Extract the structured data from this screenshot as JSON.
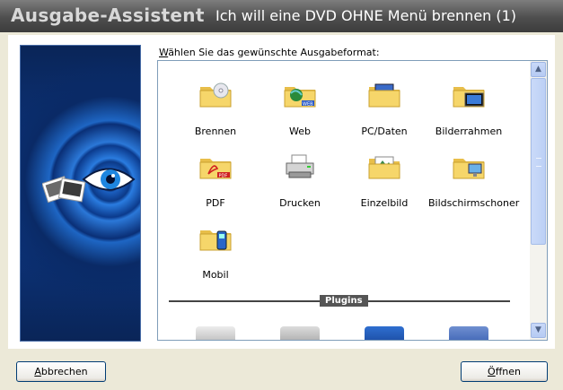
{
  "window": {
    "title_left": "Ausgabe-Assistent",
    "title_right": "Ich will eine DVD OHNE Menü brennen (1)"
  },
  "prompt": {
    "accelerator": "W",
    "rest": "ählen Sie das gewünschte Ausgabeformat:"
  },
  "formats": [
    {
      "label": "Brennen",
      "icon": "folder-disc-icon"
    },
    {
      "label": "Web",
      "icon": "folder-web-icon"
    },
    {
      "label": "PC/Daten",
      "icon": "folder-pc-icon"
    },
    {
      "label": "Bilderrahmen",
      "icon": "folder-photoframe-icon"
    },
    {
      "label": "PDF",
      "icon": "folder-pdf-icon"
    },
    {
      "label": "Drucken",
      "icon": "printer-icon"
    },
    {
      "label": "Einzelbild",
      "icon": "folder-picture-icon"
    },
    {
      "label": "Bildschirmschoner",
      "icon": "folder-monitor-icon"
    },
    {
      "label": "Mobil",
      "icon": "folder-phone-icon"
    }
  ],
  "section": {
    "plugins_label": "Plugins"
  },
  "buttons": {
    "cancel_accel": "A",
    "cancel_rest": "bbrechen",
    "open_accel": "Ö",
    "open_rest": "ffnen"
  },
  "colors": {
    "titlebar": "#4e4e4e",
    "banner": "#0d3a8a",
    "folder": "#f6d66a",
    "scrollbar": "#bcd0f5"
  }
}
